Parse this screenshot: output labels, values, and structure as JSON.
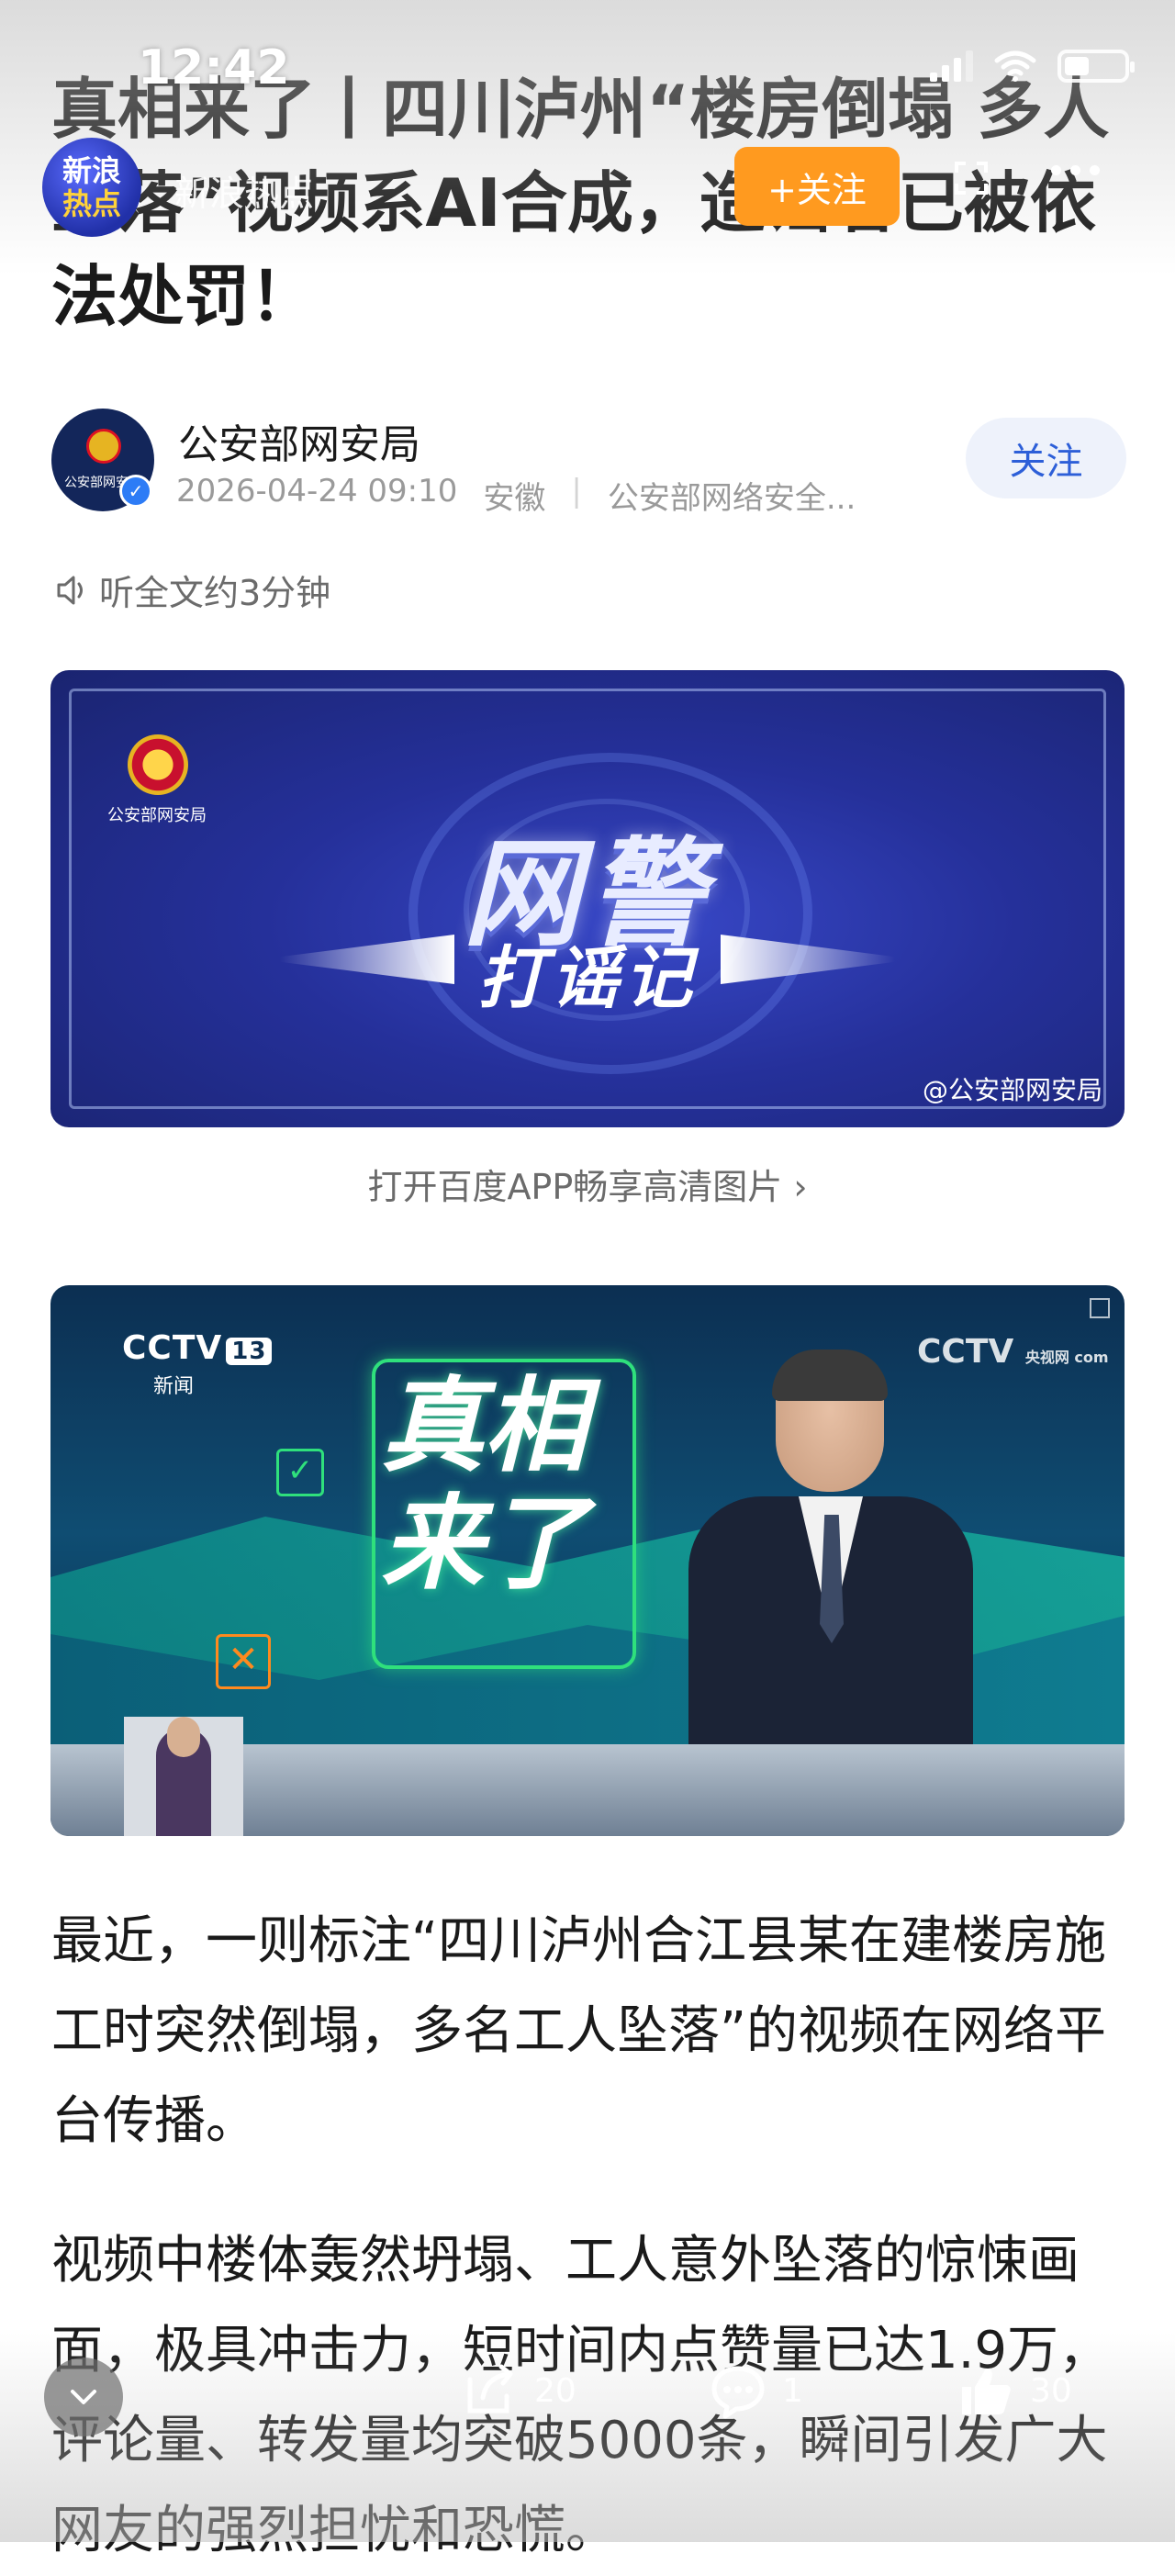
{
  "status_bar": {
    "time": "12:42"
  },
  "source_header": {
    "logo_text_line1": "新浪",
    "logo_text_line2": "热点",
    "name": "新浪热点",
    "follow_label": "+关注"
  },
  "article": {
    "title": "真相来了丨四川泸州“楼房倒塌 多人坠落”视频系AI合成，造谣者已被依法处罚！",
    "author": {
      "name": "公安部网安局",
      "avatar_label": "公安部网安局",
      "date": "2026-04-24 09:10",
      "location": "安徽",
      "source": "公安部网络安全...",
      "follow_label": "关注"
    },
    "listen_label": "听全文约3分钟",
    "image1": {
      "logo_text": "公安部网安局",
      "big_text": "网警",
      "sub_text": "打谣记",
      "watermark": "@公安部网安局"
    },
    "hd_link": "打开百度APP畅享高清图片 ›",
    "image2": {
      "channel": "CCTV",
      "channel_num": "13",
      "channel_sub": "新闻",
      "site": "CCTV",
      "site_sub": "央视网 com",
      "title": "真相来了"
    },
    "paragraphs": [
      "最近，一则标注“四川泸州合江县某在建楼房施工时突然倒塌，多名工人坠落”的视频在网络平台传播。",
      "视频中楼体轰然坍塌、工人意外坠落的惊悚画面，极具冲击力，短时间内点赞量已达1.9万，评论量、转发量均突破5000条，瞬间引发广大网友的强烈担忧和恐慌。"
    ]
  },
  "bottom_bar": {
    "share_count": "20",
    "comment_count": "1",
    "like_count": "30"
  }
}
